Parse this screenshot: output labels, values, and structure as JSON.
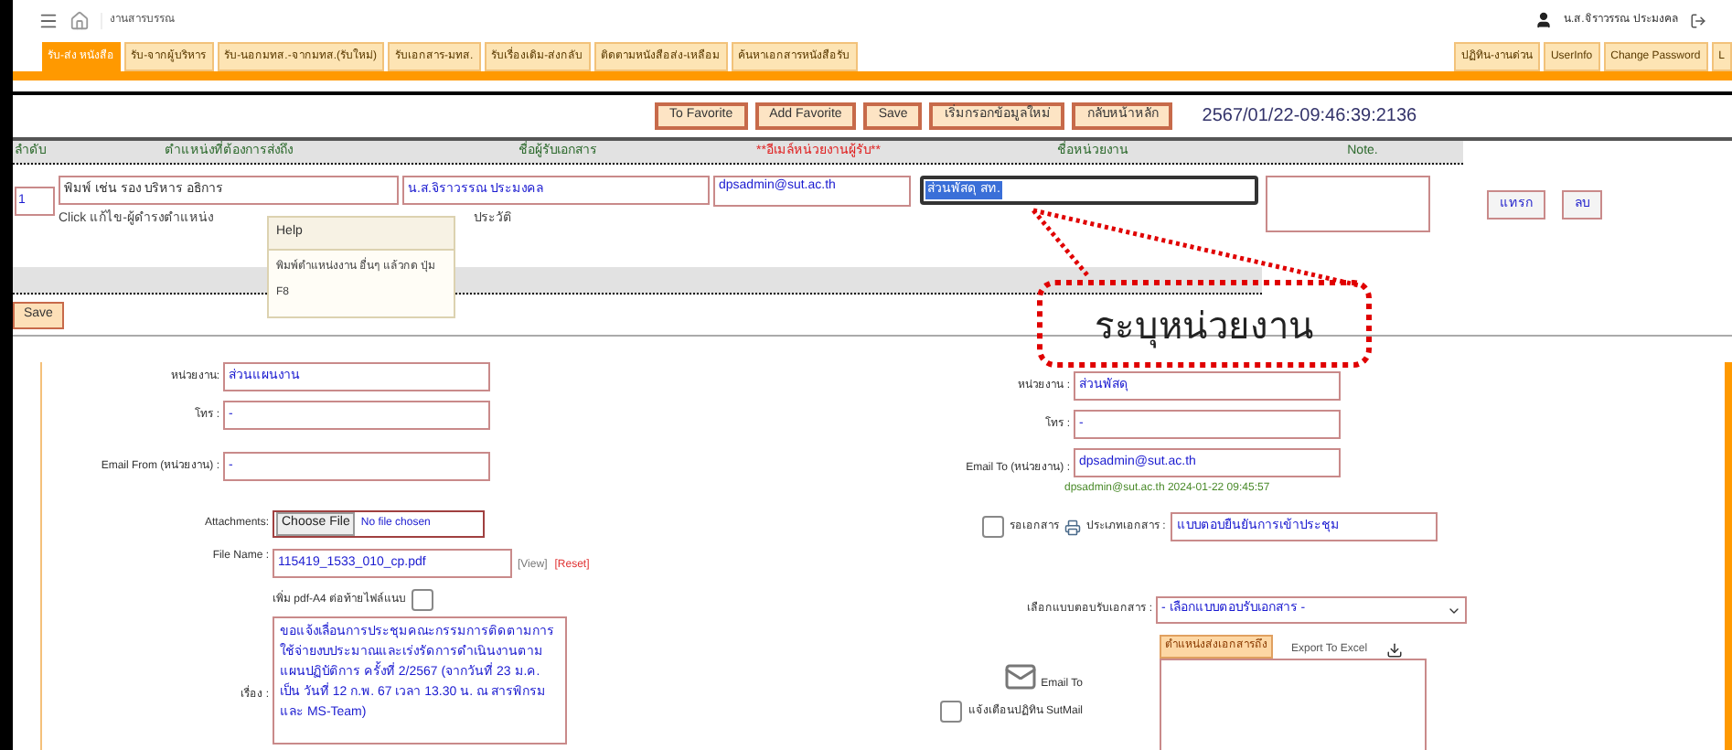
{
  "breadcrumb": "งานสารบรรณ",
  "user": "น.ส.จิราวรรณ ประมงคล",
  "tabs": [
    {
      "label": "รับ-ส่ง หนังสือ",
      "selected": true
    },
    {
      "label": "รับ-จากผู้บริหาร",
      "selected": false
    },
    {
      "label": "รับ-นอกมทส.-จากมทส.(รับใหม่)",
      "selected": false
    },
    {
      "label": "รับเอกสาร-มทส.",
      "selected": false
    },
    {
      "label": "รับเรื่องเดิม-ส่งกลับ",
      "selected": false
    },
    {
      "label": "ติดตามหนังสือส่ง-เหลือม",
      "selected": false
    },
    {
      "label": "ค้นหาเอกสารหนังสือรับ",
      "selected": false
    }
  ],
  "right_tabs": [
    "ปฏิทิน-งานด่วน",
    "UserInfo",
    "Change Password",
    "L"
  ],
  "toolbar": {
    "buttons": [
      "To Favorite",
      "Add Favorite",
      "Save",
      "เริ่มกรอกข้อมูลใหม่",
      "กลับหน้าหลัก"
    ],
    "timestamp": "2567/01/22-09:46:39:2136"
  },
  "recipients": {
    "columns": [
      {
        "label": "ลำดับ",
        "required": false
      },
      {
        "label": "ตำแหน่งที่ต้องการส่งถึง",
        "required": false
      },
      {
        "label": "ชื่อผู้รับเอกสาร",
        "required": false
      },
      {
        "label": "**อีเมล์หน่วยงานผู้รับ**",
        "required": true
      },
      {
        "label": "ชื่อหน่วยงาน",
        "required": false
      },
      {
        "label": "Note.",
        "required": false
      }
    ],
    "rows": [
      {
        "order": "1",
        "position": "พิมพ์ เช่น รอง บริหาร อธิการ",
        "position_hint": "Click แก้ไข-ผู้ดำรงตำแหน่ง",
        "recipient": "น.ส.จิราวรรณ  ประมงคล",
        "recipient_link": "ประวัติ",
        "email": "dpsadmin@sut.ac.th",
        "unit": "ส่วนพัสดุ  สท.",
        "unit_selected": true
      }
    ],
    "row_buttons": [
      "แทรก",
      "ลบ"
    ],
    "save_button": "Save"
  },
  "help_popup": {
    "title": "Help",
    "text": "พิมพ์ตำแหน่งงาน อื่นๆ แล้วกด ปุ่ม F8"
  },
  "sender": {
    "unit_label": "หน่วยงาน:",
    "unit": "ส่วนแผนงาน",
    "phone_label": "โทร :",
    "phone": "-",
    "email_label": "Email From (หน่วยงาน) :",
    "email": "-",
    "attach_label": "Attachments:",
    "choose_button": "Choose File",
    "no_file": "No file chosen",
    "file_label": "File Name :",
    "file": "115419_1533_010_cp.pdf",
    "view": "[View]",
    "reset": "[Reset]",
    "append_label": "เพิ่ม pdf-A4 ต่อท้ายไฟล์แนบ",
    "append_checked": false,
    "subject_label": "เรื่อง :",
    "subject": "ขอแจ้งเลื่อนการประชุมคณะกรรมการติดตามการใช้จ่ายงบประมาณและเร่งรัดการดำเนินงานตามแผนปฏิบัติการ ครั้งที่ 2/2567 (จากวันที่ 23 ม.ค. เป็น วันที่ 12 ก.พ. 67 เวลา 13.30 น. ณ สารพิกรม และ MS-Team)"
  },
  "receiver": {
    "unit_label": "หน่วยงาน :",
    "unit": "ส่วนพัสดุ",
    "phone_label": "โทร :",
    "phone": "-",
    "email_label": "Email To (หน่วยงาน) :",
    "email": "dpsadmin@sut.ac.th",
    "sent_info": "dpsadmin@sut.ac.th 2024-01-22 09:45:57",
    "wait_label": "รอเอกสาร",
    "wait_checked": false,
    "type_label": "ประเภทเอกสาร :",
    "type": "แบบตอบยืนยันการเข้าประชุม",
    "reply_label": "เลือกแบบตอบรับเอกสาร :",
    "reply": "- เลือกแบบตอบรับเอกสาร -",
    "list_tab": "ตำแหน่งส่งเอกสารถึง",
    "export": "Export To Excel",
    "email_to": "Email To",
    "notify_label": "แจ้งเตือนปฏิทิน SutMail",
    "notify_checked": false
  },
  "annotation": "ระบุหน่วยงาน"
}
